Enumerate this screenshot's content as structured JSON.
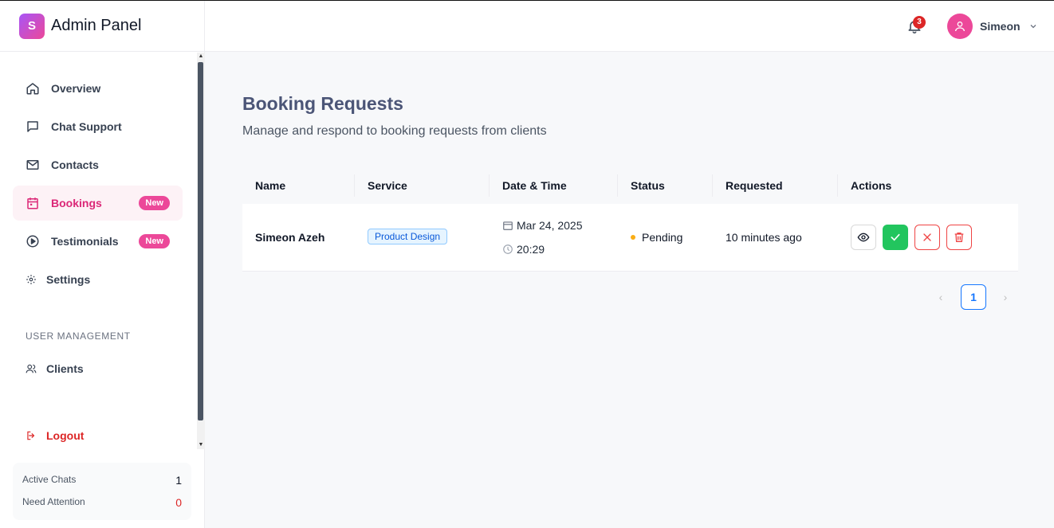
{
  "brand": {
    "logo_letter": "S",
    "title": "Admin Panel"
  },
  "nav": {
    "items": [
      {
        "label": "Overview",
        "icon": "home-icon"
      },
      {
        "label": "Chat Support",
        "icon": "chat-icon"
      },
      {
        "label": "Contacts",
        "icon": "mail-icon"
      },
      {
        "label": "Bookings",
        "icon": "calendar-icon",
        "badge": "New",
        "active": true
      },
      {
        "label": "Testimonials",
        "icon": "play-circle-icon",
        "badge": "New"
      },
      {
        "label": "Settings",
        "icon": "gear-icon"
      }
    ],
    "section_label": "USER MANAGEMENT",
    "clients_label": "Clients",
    "logout_label": "Logout"
  },
  "stats": {
    "active_chats_label": "Active Chats",
    "active_chats_value": "1",
    "need_attention_label": "Need Attention",
    "need_attention_value": "0"
  },
  "header": {
    "notification_count": "3",
    "user_name": "Simeon"
  },
  "main": {
    "title": "Booking Requests",
    "subtitle": "Manage and respond to booking requests from clients",
    "columns": [
      "Name",
      "Service",
      "Date & Time",
      "Status",
      "Requested",
      "Actions"
    ],
    "rows": [
      {
        "name": "Simeon Azeh",
        "service": "Product Design",
        "date": "Mar 24, 2025",
        "time": "20:29",
        "status": "Pending",
        "requested": "10 minutes ago"
      }
    ],
    "pagination": {
      "current_page": "1",
      "prev": "‹",
      "next": "›"
    }
  },
  "colors": {
    "accent": "#db2777",
    "badge": "#ec4899",
    "approve": "#22c55e",
    "reject": "#ef4444",
    "pending": "#faad14",
    "link": "#1677ff"
  }
}
